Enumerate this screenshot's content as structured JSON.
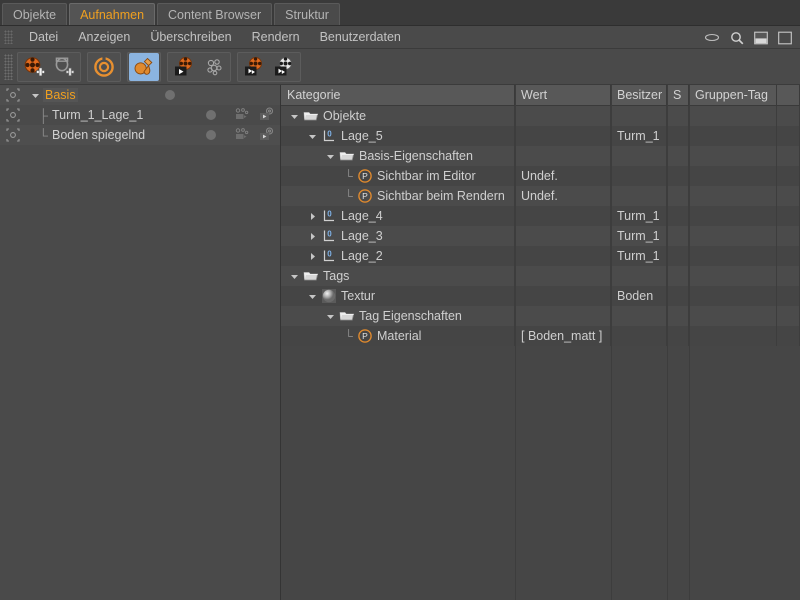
{
  "window": {
    "controls": [
      {
        "name": "eye-icon",
        "label": "eye"
      },
      {
        "name": "search-icon",
        "label": "search"
      },
      {
        "name": "layout-split-icon",
        "label": "layout split"
      },
      {
        "name": "layout-single-icon",
        "label": "layout single"
      }
    ]
  },
  "tabs": [
    {
      "label": "Objekte",
      "active": false
    },
    {
      "label": "Aufnahmen",
      "active": true
    },
    {
      "label": "Content Browser",
      "active": false
    },
    {
      "label": "Struktur",
      "active": false
    }
  ],
  "menu": {
    "items": [
      "Datei",
      "Anzeigen",
      "Überschreiben",
      "Rendern",
      "Benutzerdaten"
    ]
  },
  "toolbar": {
    "groups": [
      {
        "buttons": [
          {
            "name": "add-take-icon",
            "label": "Neue Aufnahme",
            "selected": false
          },
          {
            "name": "add-camera-take-icon",
            "label": "Neue Kamera-Aufnahme",
            "selected": false
          }
        ]
      },
      {
        "buttons": [
          {
            "name": "auto-take-icon",
            "label": "Automatisch",
            "selected": false
          }
        ]
      },
      {
        "buttons": [
          {
            "name": "overrides-icon",
            "label": "Überschreibungen",
            "selected": true
          }
        ]
      },
      {
        "buttons": [
          {
            "name": "render-take-icon",
            "label": "Aufnahme rendern",
            "selected": false
          },
          {
            "name": "render-preview-icon",
            "label": "Vorschau rendern",
            "selected": false
          }
        ]
      },
      {
        "buttons": [
          {
            "name": "render-marked-icon",
            "label": "Markierte rendern",
            "selected": false
          },
          {
            "name": "render-all-icon",
            "label": "Alle rendern",
            "selected": false
          }
        ]
      }
    ]
  },
  "objects": {
    "rows": [
      {
        "name": "Basis",
        "indent": 0,
        "selected": true,
        "expander": "down",
        "dot": true,
        "extra_icons": false
      },
      {
        "name": "Turm_1_Lage_1",
        "indent": 1,
        "selected": false,
        "expander": "none",
        "dot": true,
        "extra_icons": true
      },
      {
        "name": "Boden spiegelnd",
        "indent": 1,
        "selected": false,
        "expander": "none",
        "dot": true,
        "extra_icons": true
      }
    ]
  },
  "table": {
    "columns": [
      {
        "key": "kategorie",
        "label": "Kategorie"
      },
      {
        "key": "wert",
        "label": "Wert"
      },
      {
        "key": "besitzer",
        "label": "Besitzer"
      },
      {
        "key": "s",
        "label": "S"
      },
      {
        "key": "gruppen",
        "label": "Gruppen-Tag"
      }
    ],
    "rows": [
      {
        "label": "Objekte",
        "icon": "folder-icon",
        "indent": 0,
        "expander": "down",
        "wert": "",
        "besitzer": "",
        "s": "",
        "gruppen": ""
      },
      {
        "label": "Lage_5",
        "icon": "layer-icon",
        "indent": 1,
        "expander": "down",
        "wert": "",
        "besitzer": "Turm_1",
        "s": "",
        "gruppen": ""
      },
      {
        "label": "Basis-Eigenschaften",
        "icon": "folder-icon",
        "indent": 2,
        "expander": "down",
        "wert": "",
        "besitzer": "",
        "s": "",
        "gruppen": ""
      },
      {
        "label": "Sichtbar im Editor",
        "icon": "param-icon",
        "indent": 3,
        "expander": "none",
        "wert": "Undef.",
        "besitzer": "",
        "s": "",
        "gruppen": ""
      },
      {
        "label": "Sichtbar beim Rendern",
        "icon": "param-icon",
        "indent": 3,
        "expander": "none",
        "wert": "Undef.",
        "besitzer": "",
        "s": "",
        "gruppen": ""
      },
      {
        "label": "Lage_4",
        "icon": "layer-icon",
        "indent": 1,
        "expander": "right",
        "wert": "",
        "besitzer": "Turm_1",
        "s": "",
        "gruppen": ""
      },
      {
        "label": "Lage_3",
        "icon": "layer-icon",
        "indent": 1,
        "expander": "right",
        "wert": "",
        "besitzer": "Turm_1",
        "s": "",
        "gruppen": ""
      },
      {
        "label": "Lage_2",
        "icon": "layer-icon",
        "indent": 1,
        "expander": "right",
        "wert": "",
        "besitzer": "Turm_1",
        "s": "",
        "gruppen": ""
      },
      {
        "label": "Tags",
        "icon": "folder-icon",
        "indent": 0,
        "expander": "down",
        "wert": "",
        "besitzer": "",
        "s": "",
        "gruppen": ""
      },
      {
        "label": "Textur",
        "icon": "texture-icon",
        "indent": 1,
        "expander": "down",
        "wert": "",
        "besitzer": "Boden",
        "s": "",
        "gruppen": ""
      },
      {
        "label": "Tag Eigenschaften",
        "icon": "folder-icon",
        "indent": 2,
        "expander": "down",
        "wert": "",
        "besitzer": "",
        "s": "",
        "gruppen": ""
      },
      {
        "label": "Material",
        "icon": "param-icon",
        "indent": 3,
        "expander": "none",
        "wert": "[ Boden_matt ]",
        "besitzer": "",
        "s": "",
        "gruppen": ""
      }
    ]
  },
  "colors": {
    "accent": "#f0a020",
    "selection": "#8bb4e0",
    "panel": "#4a4a4a",
    "panel_dark": "#454545",
    "header": "#585858",
    "text": "#cfcfcf"
  }
}
